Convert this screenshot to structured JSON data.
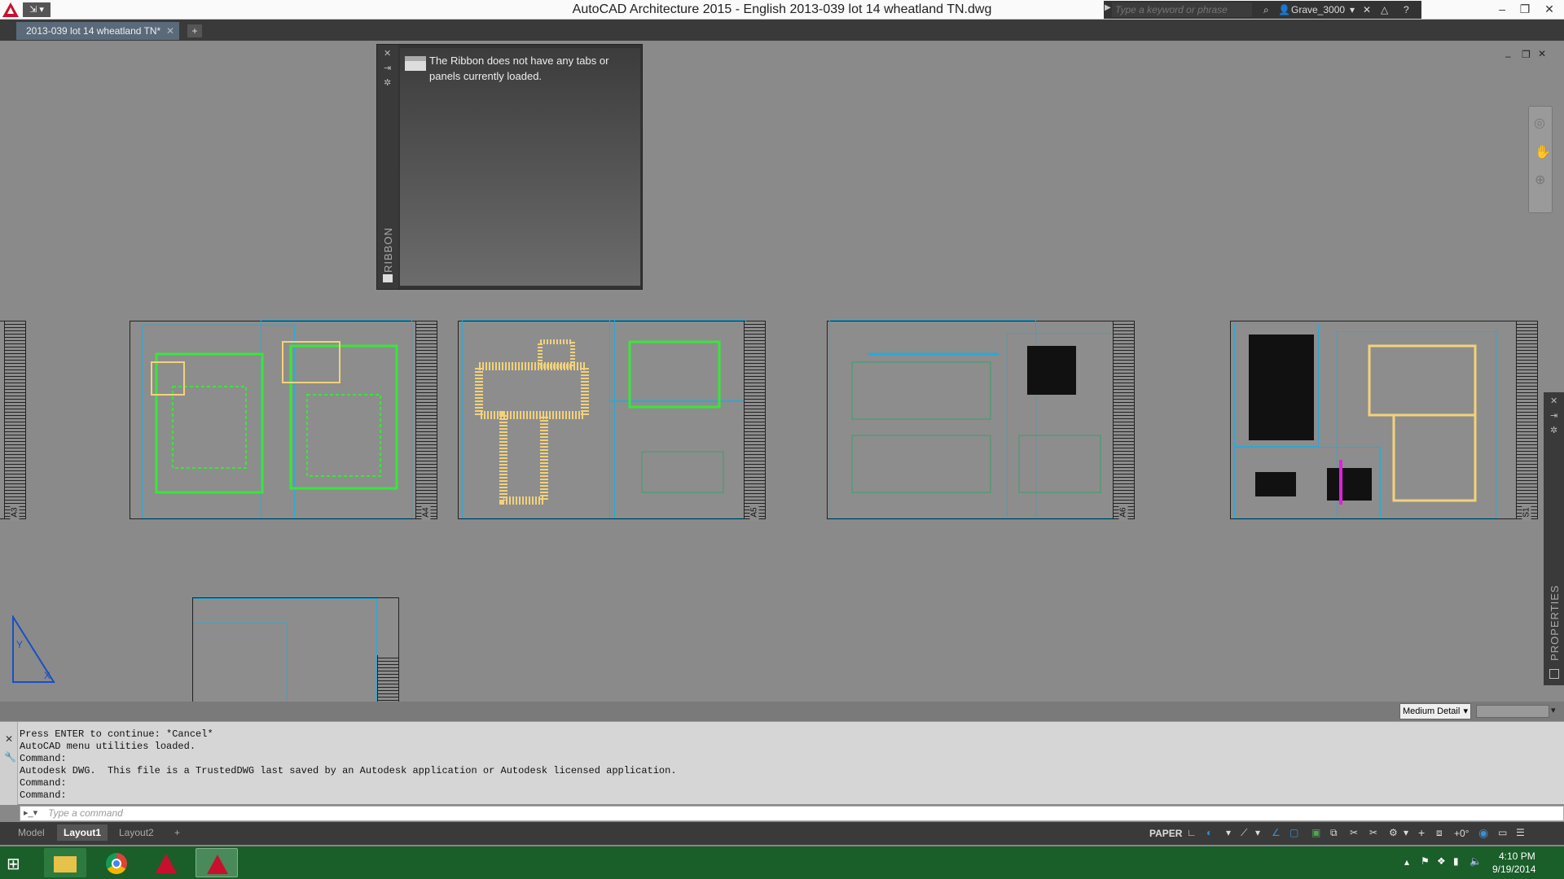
{
  "window": {
    "title": "AutoCAD Architecture 2015 - English    2013-039 lot 14 wheatland TN.dwg",
    "search_placeholder": "Type a keyword or phrase",
    "user": "Grave_3000"
  },
  "tabs": {
    "doc": "2013-039 lot 14 wheatland TN*",
    "new_glyph": "+"
  },
  "ribbon": {
    "message": "The Ribbon does not have any tabs or panels currently loaded.",
    "label": "RIBBON"
  },
  "properties_label": "PROPERTIES",
  "detail_level": "Medium Detail",
  "command": {
    "lines": [
      "Press ENTER to continue: *Cancel*",
      "AutoCAD menu utilities loaded.",
      "Command:",
      "Autodesk DWG.  This file is a TrustedDWG last saved by an Autodesk application or Autodesk licensed application.",
      "Command:",
      "Command:"
    ],
    "placeholder": "Type a command"
  },
  "layout_tabs": {
    "model": "Model",
    "layout1": "Layout1",
    "layout2": "Layout2",
    "add": "+"
  },
  "status": {
    "paper": "PAPER",
    "angle": "+0°"
  },
  "clock": {
    "time": "4:10 PM",
    "date": "9/19/2014"
  },
  "sheets": [
    {
      "id": "A3",
      "label": "A3"
    },
    {
      "id": "A4",
      "label": "A4"
    },
    {
      "id": "A5",
      "label": "A5"
    },
    {
      "id": "A6",
      "label": "A6"
    },
    {
      "id": "S1",
      "label": "S1"
    }
  ],
  "colors": {
    "accent_cyan": "#29a9d4",
    "plan_green": "#39e639",
    "plan_yellow": "#f2d27a"
  }
}
